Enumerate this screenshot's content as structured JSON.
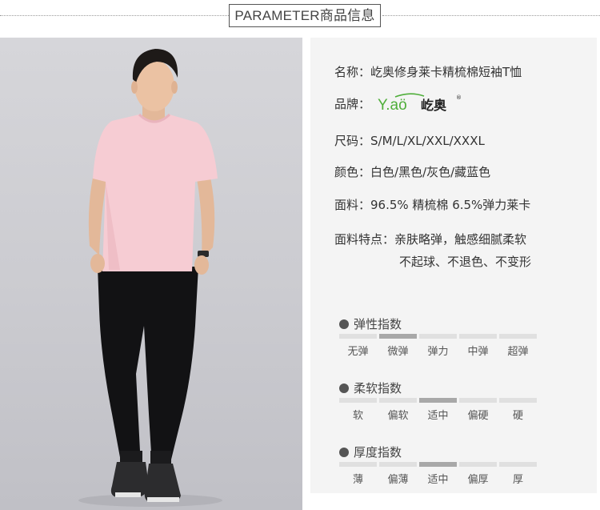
{
  "header": {
    "title": "PARAMETER商品信息"
  },
  "params": {
    "name": {
      "label": "名称：",
      "value": "屹奥修身莱卡精梳棉短袖T恤"
    },
    "brand": {
      "label": "品牌：",
      "logo_text": "Y.aö",
      "logo_cn": "屹奥"
    },
    "size": {
      "label": "尺码：",
      "value": "S/M/L/XL/XXL/XXXL"
    },
    "color": {
      "label": "颜色：",
      "value": "白色/黑色/灰色/藏蓝色"
    },
    "fabric": {
      "label": "面料：",
      "value": "96.5% 精梳棉  6.5%弹力莱卡"
    },
    "features": {
      "label": "面料特点：",
      "line1": "亲肤略弹，触感细腻柔软",
      "line2": "不起球、不退色、不变形"
    }
  },
  "indices": [
    {
      "title": "弹性指数",
      "levels": [
        "无弹",
        "微弹",
        "弹力",
        "中弹",
        "超弹"
      ],
      "selected": 1
    },
    {
      "title": "柔软指数",
      "levels": [
        "软",
        "偏软",
        "适中",
        "偏硬",
        "硬"
      ],
      "selected": 2
    },
    {
      "title": "厚度指数",
      "levels": [
        "薄",
        "偏薄",
        "适中",
        "偏厚",
        "厚"
      ],
      "selected": 2
    }
  ],
  "colors": {
    "bar_on": "#a8a8a8",
    "bar_off": "#e0e0e0",
    "panel_bg": "#f4f4f4",
    "logo_green": "#4fae3a"
  }
}
